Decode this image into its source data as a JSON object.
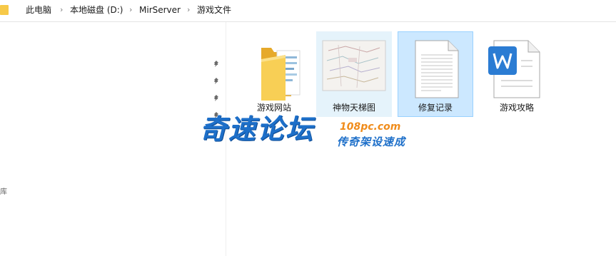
{
  "address_bar": {
    "breadcrumbs": [
      "此电脑",
      "本地磁盘 (D:)",
      "MirServer",
      "游戏文件"
    ],
    "separator": "›"
  },
  "navigation_pane": {
    "pinned_icon": "pin-icon",
    "partial_label": "库"
  },
  "files": [
    {
      "name": "游戏网站",
      "type": "folder",
      "icon": "folder-icon",
      "state": "normal"
    },
    {
      "name": "神物天梯图",
      "type": "image",
      "icon": "image-thumbnail-icon",
      "state": "hover"
    },
    {
      "name": "修复记录",
      "type": "text",
      "icon": "text-document-icon",
      "state": "selected"
    },
    {
      "name": "游戏攻略",
      "type": "word",
      "icon": "word-document-icon",
      "state": "normal"
    }
  ],
  "watermark": {
    "title": "奇速论坛",
    "url": "108pc.com",
    "subtitle": "传奇架设速成"
  },
  "colors": {
    "folder": "#f7c948",
    "hover_bg": "#e5f3fb",
    "selected_bg": "#cce8ff",
    "selected_border": "#99d1ff",
    "word_blue": "#2b7cd3",
    "watermark_blue": "#1d6fc9",
    "watermark_orange": "#f08c1b"
  }
}
